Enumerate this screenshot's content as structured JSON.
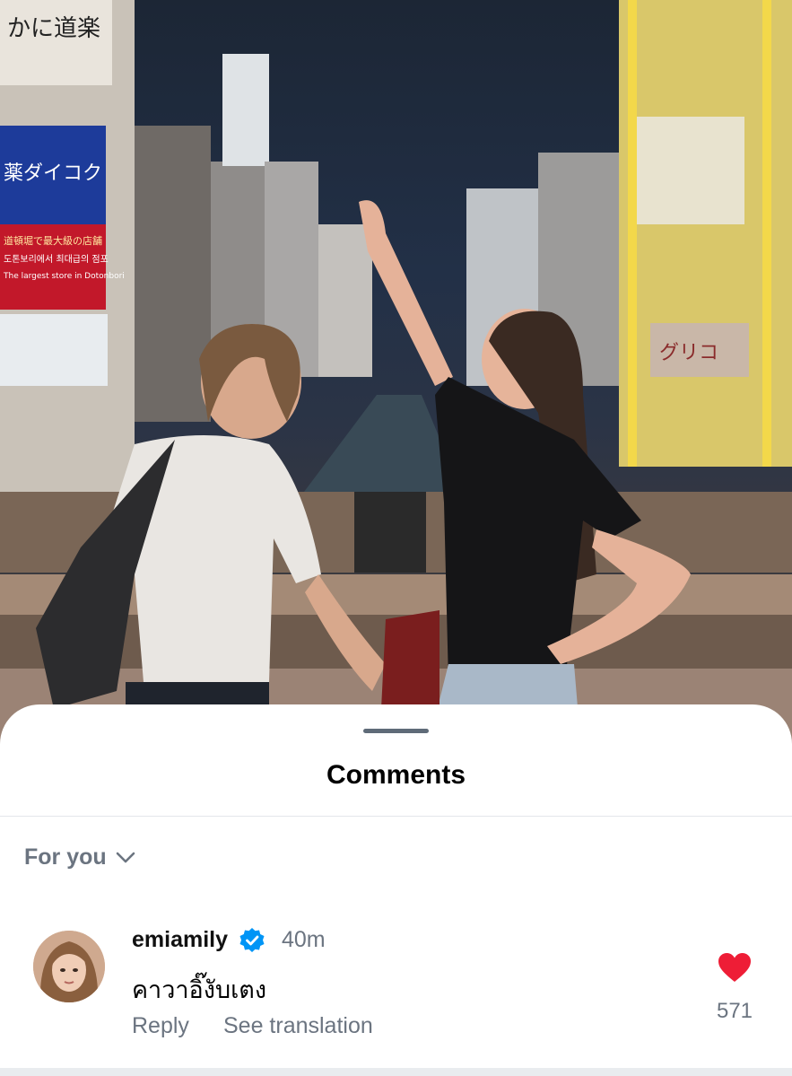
{
  "photo": {
    "signs": {
      "daikoku": "薬ダイコク",
      "daikoku_sub": "道頓堀で最大級の店舗",
      "korean": "도톤보리에서 최대급의 점포",
      "english": "The largest store in Dotonbori",
      "kani": "かに道楽",
      "glico": "グリコ"
    }
  },
  "comments_sheet": {
    "title": "Comments",
    "filter_label": "For you",
    "comments": [
      {
        "username": "emiamily",
        "time": "40m",
        "text": "คาวาอิ๊งับเตง",
        "reply_label": "Reply",
        "translate_label": "See translation",
        "like_count": "571"
      }
    ]
  },
  "colors": {
    "like": "#ee1d36",
    "verified": "#0095f6",
    "muted_text": "#6b7480"
  },
  "icons": {
    "filter_chevron": "chevron-down-icon",
    "verified": "verified-badge-icon",
    "like": "heart-icon"
  }
}
